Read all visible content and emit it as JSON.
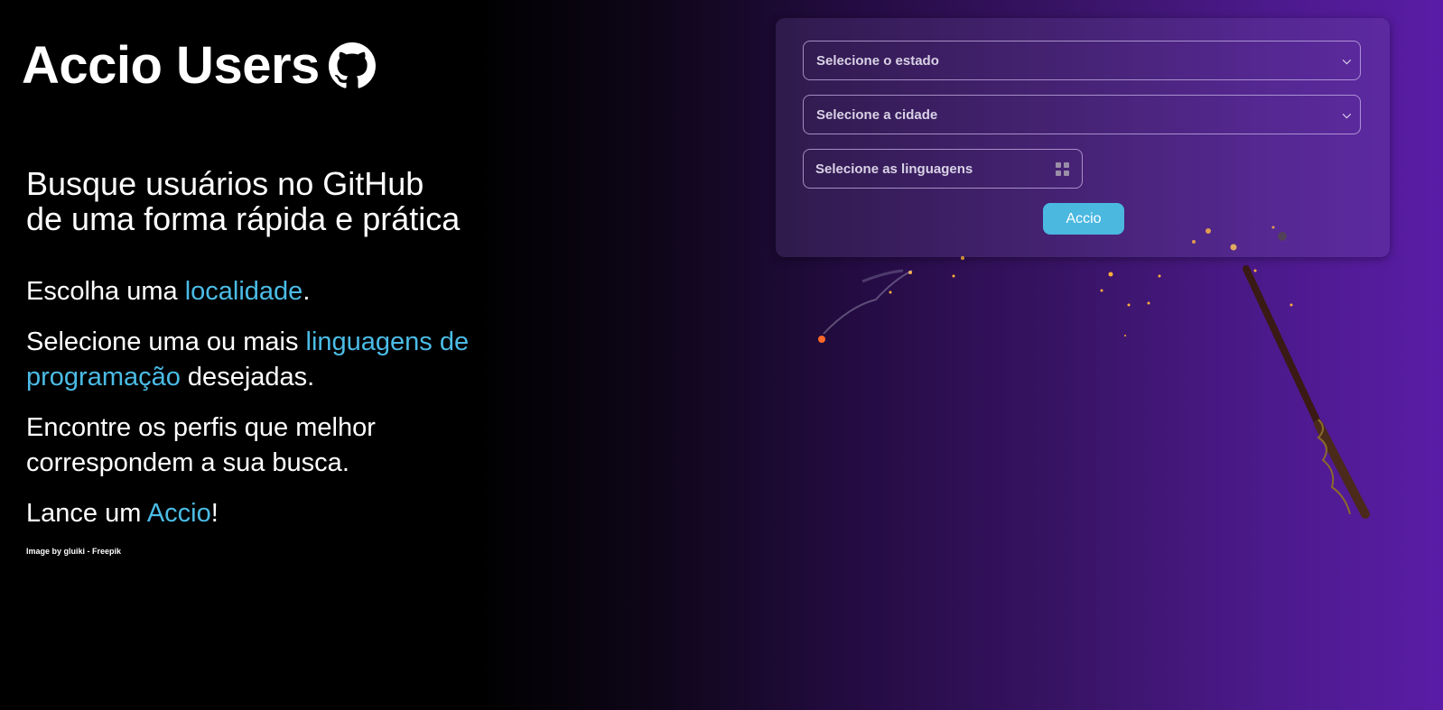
{
  "brand": {
    "title": "Accio Users",
    "icon": "github-icon"
  },
  "hero": {
    "headline_line1": "Busque usuários no GitHub",
    "headline_line2": "de uma forma rápida e prática",
    "step1_pre": "Escolha uma ",
    "step1_highlight": "localidade",
    "step1_post": ".",
    "step2_pre": "Selecione uma ou mais ",
    "step2_highlight": "linguagens de programação",
    "step2_post": " desejadas.",
    "step3": "Encontre os perfis que melhor correspondem a sua busca.",
    "step4_pre": "Lance um ",
    "step4_highlight": "Accio",
    "step4_post": "!",
    "credit": "Image by gluiki - Freepik"
  },
  "form": {
    "state_placeholder": "Selecione o estado",
    "city_placeholder": "Selecione a cidade",
    "languages_placeholder": "Selecione as linguagens",
    "submit_label": "Accio"
  },
  "colors": {
    "highlight": "#4bbce6",
    "button": "#4bb8e0",
    "gradient_end": "#5a1ca6"
  }
}
